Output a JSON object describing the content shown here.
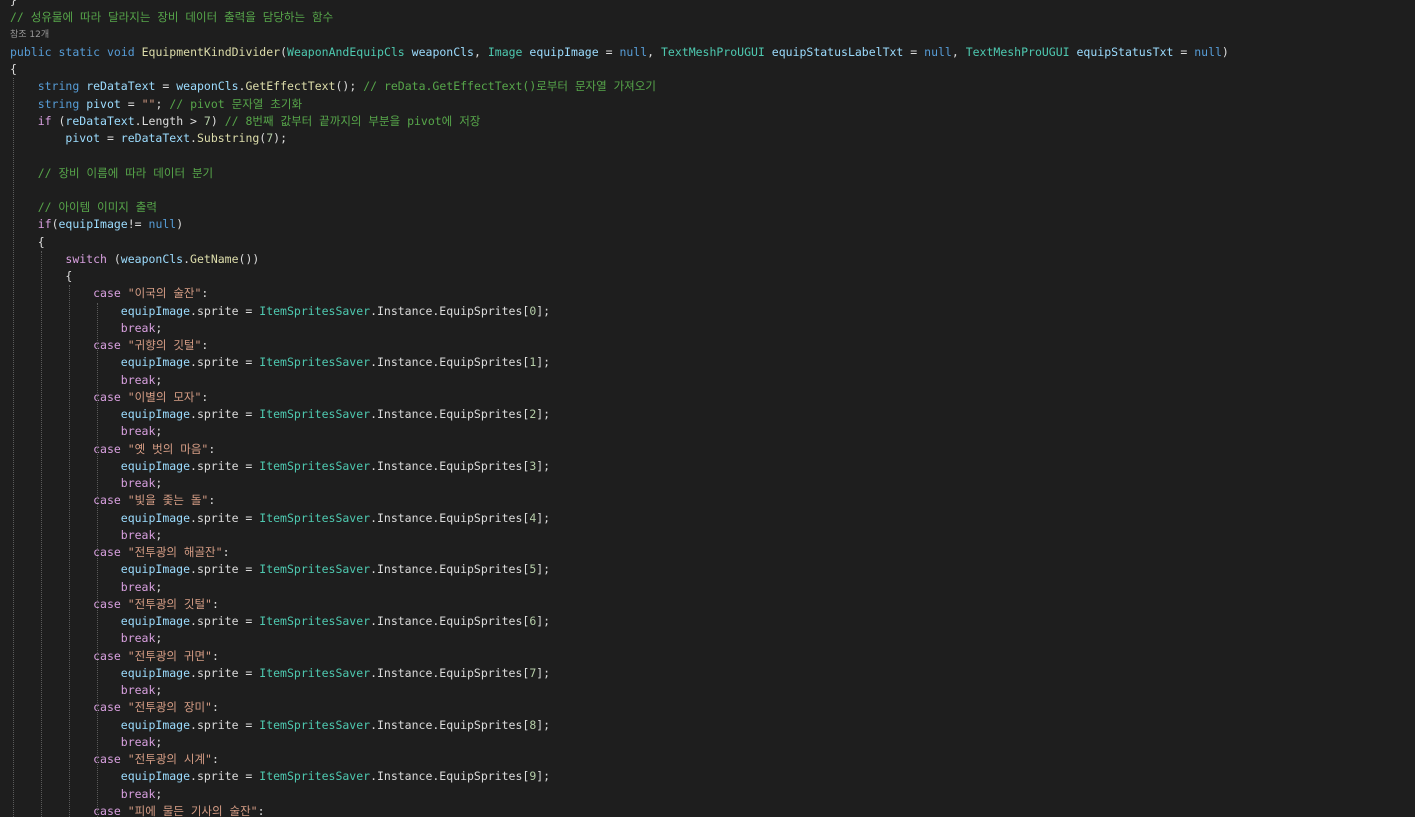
{
  "colors": {
    "background": "#1e1e1e",
    "plain": "#dcdcdc",
    "keyword": "#569cd6",
    "control": "#d8a0df",
    "comment": "#57a64a",
    "string": "#d69d85",
    "type": "#4ec9b0",
    "method": "#dcdcaa",
    "variable": "#9cdcfe",
    "number": "#b5cea8",
    "codelens": "#999999"
  },
  "code": {
    "codelens": "참조 12개",
    "lines": [
      [
        [
          "pl",
          "}"
        ]
      ],
      [
        [
          "cm",
          "// 성유물에 따라 달라지는 장비 데이터 출력을 담당하는 함수"
        ]
      ],
      "codelens",
      [
        [
          "kw",
          "public"
        ],
        [
          "pl",
          " "
        ],
        [
          "kw",
          "static"
        ],
        [
          "pl",
          " "
        ],
        [
          "kw",
          "void"
        ],
        [
          "pl",
          " "
        ],
        [
          "fn",
          "EquipmentKindDivider"
        ],
        [
          "pl",
          "("
        ],
        [
          "type",
          "WeaponAndEquipCls"
        ],
        [
          "pl",
          " "
        ],
        [
          "var",
          "weaponCls"
        ],
        [
          "pl",
          ", "
        ],
        [
          "type",
          "Image"
        ],
        [
          "pl",
          " "
        ],
        [
          "var",
          "equipImage"
        ],
        [
          "pl",
          " = "
        ],
        [
          "kw",
          "null"
        ],
        [
          "pl",
          ", "
        ],
        [
          "type",
          "TextMeshProUGUI"
        ],
        [
          "pl",
          " "
        ],
        [
          "var",
          "equipStatusLabelTxt"
        ],
        [
          "pl",
          " = "
        ],
        [
          "kw",
          "null"
        ],
        [
          "pl",
          ", "
        ],
        [
          "type",
          "TextMeshProUGUI"
        ],
        [
          "pl",
          " "
        ],
        [
          "var",
          "equipStatusTxt"
        ],
        [
          "pl",
          " = "
        ],
        [
          "kw",
          "null"
        ],
        [
          "pl",
          ")"
        ]
      ],
      [
        [
          "pl",
          "{"
        ]
      ],
      [
        [
          "pl",
          "    "
        ],
        [
          "kw",
          "string"
        ],
        [
          "pl",
          " "
        ],
        [
          "var",
          "reDataText"
        ],
        [
          "pl",
          " = "
        ],
        [
          "var",
          "weaponCls"
        ],
        [
          "pl",
          "."
        ],
        [
          "fn",
          "GetEffectText"
        ],
        [
          "pl",
          "(); "
        ],
        [
          "cm",
          "// reData.GetEffectText()로부터 문자열 가져오기"
        ]
      ],
      [
        [
          "pl",
          "    "
        ],
        [
          "kw",
          "string"
        ],
        [
          "pl",
          " "
        ],
        [
          "var",
          "pivot"
        ],
        [
          "pl",
          " = "
        ],
        [
          "str",
          "\"\""
        ],
        [
          "pl",
          "; "
        ],
        [
          "cm",
          "// pivot 문자열 초기화"
        ]
      ],
      [
        [
          "pl",
          "    "
        ],
        [
          "ctl",
          "if"
        ],
        [
          "pl",
          " ("
        ],
        [
          "var",
          "reDataText"
        ],
        [
          "pl",
          ".Length > "
        ],
        [
          "num",
          "7"
        ],
        [
          "pl",
          ") "
        ],
        [
          "cm",
          "// 8번째 값부터 끝까지의 부분을 pivot에 저장"
        ]
      ],
      [
        [
          "pl",
          "        "
        ],
        [
          "var",
          "pivot"
        ],
        [
          "pl",
          " = "
        ],
        [
          "var",
          "reDataText"
        ],
        [
          "pl",
          "."
        ],
        [
          "fn",
          "Substring"
        ],
        [
          "pl",
          "("
        ],
        [
          "num",
          "7"
        ],
        [
          "pl",
          ");"
        ]
      ],
      [],
      [
        [
          "pl",
          "    "
        ],
        [
          "cm",
          "// 장비 이름에 따라 데이터 분기"
        ]
      ],
      [],
      [
        [
          "pl",
          "    "
        ],
        [
          "cm",
          "// 아이템 이미지 출력"
        ]
      ],
      [
        [
          "pl",
          "    "
        ],
        [
          "ctl",
          "if"
        ],
        [
          "pl",
          "("
        ],
        [
          "var",
          "equipImage"
        ],
        [
          "pl",
          "!= "
        ],
        [
          "kw",
          "null"
        ],
        [
          "pl",
          ")"
        ]
      ],
      [
        [
          "pl",
          "    {"
        ]
      ],
      [
        [
          "pl",
          "        "
        ],
        [
          "ctl",
          "switch"
        ],
        [
          "pl",
          " ("
        ],
        [
          "var",
          "weaponCls"
        ],
        [
          "pl",
          "."
        ],
        [
          "fn",
          "GetName"
        ],
        [
          "pl",
          "())"
        ]
      ],
      [
        [
          "pl",
          "        {"
        ]
      ],
      [
        [
          "pl",
          "            "
        ],
        [
          "ctl",
          "case"
        ],
        [
          "pl",
          " "
        ],
        [
          "str",
          "\"이국의 술잔\""
        ],
        [
          "pl",
          ":"
        ]
      ],
      [
        [
          "pl",
          "                "
        ],
        [
          "var",
          "equipImage"
        ],
        [
          "pl",
          ".sprite = "
        ],
        [
          "type",
          "ItemSpritesSaver"
        ],
        [
          "pl",
          ".Instance.EquipSprites["
        ],
        [
          "num",
          "0"
        ],
        [
          "pl",
          "];"
        ]
      ],
      [
        [
          "pl",
          "                "
        ],
        [
          "ctl",
          "break"
        ],
        [
          "pl",
          ";"
        ]
      ],
      [
        [
          "pl",
          "            "
        ],
        [
          "ctl",
          "case"
        ],
        [
          "pl",
          " "
        ],
        [
          "str",
          "\"귀향의 깃털\""
        ],
        [
          "pl",
          ":"
        ]
      ],
      [
        [
          "pl",
          "                "
        ],
        [
          "var",
          "equipImage"
        ],
        [
          "pl",
          ".sprite = "
        ],
        [
          "type",
          "ItemSpritesSaver"
        ],
        [
          "pl",
          ".Instance.EquipSprites["
        ],
        [
          "num",
          "1"
        ],
        [
          "pl",
          "];"
        ]
      ],
      [
        [
          "pl",
          "                "
        ],
        [
          "ctl",
          "break"
        ],
        [
          "pl",
          ";"
        ]
      ],
      [
        [
          "pl",
          "            "
        ],
        [
          "ctl",
          "case"
        ],
        [
          "pl",
          " "
        ],
        [
          "str",
          "\"이별의 모자\""
        ],
        [
          "pl",
          ":"
        ]
      ],
      [
        [
          "pl",
          "                "
        ],
        [
          "var",
          "equipImage"
        ],
        [
          "pl",
          ".sprite = "
        ],
        [
          "type",
          "ItemSpritesSaver"
        ],
        [
          "pl",
          ".Instance.EquipSprites["
        ],
        [
          "num",
          "2"
        ],
        [
          "pl",
          "];"
        ]
      ],
      [
        [
          "pl",
          "                "
        ],
        [
          "ctl",
          "break"
        ],
        [
          "pl",
          ";"
        ]
      ],
      [
        [
          "pl",
          "            "
        ],
        [
          "ctl",
          "case"
        ],
        [
          "pl",
          " "
        ],
        [
          "str",
          "\"옛 벗의 마음\""
        ],
        [
          "pl",
          ":"
        ]
      ],
      [
        [
          "pl",
          "                "
        ],
        [
          "var",
          "equipImage"
        ],
        [
          "pl",
          ".sprite = "
        ],
        [
          "type",
          "ItemSpritesSaver"
        ],
        [
          "pl",
          ".Instance.EquipSprites["
        ],
        [
          "num",
          "3"
        ],
        [
          "pl",
          "];"
        ]
      ],
      [
        [
          "pl",
          "                "
        ],
        [
          "ctl",
          "break"
        ],
        [
          "pl",
          ";"
        ]
      ],
      [
        [
          "pl",
          "            "
        ],
        [
          "ctl",
          "case"
        ],
        [
          "pl",
          " "
        ],
        [
          "str",
          "\"빛을 좇는 돌\""
        ],
        [
          "pl",
          ":"
        ]
      ],
      [
        [
          "pl",
          "                "
        ],
        [
          "var",
          "equipImage"
        ],
        [
          "pl",
          ".sprite = "
        ],
        [
          "type",
          "ItemSpritesSaver"
        ],
        [
          "pl",
          ".Instance.EquipSprites["
        ],
        [
          "num",
          "4"
        ],
        [
          "pl",
          "];"
        ]
      ],
      [
        [
          "pl",
          "                "
        ],
        [
          "ctl",
          "break"
        ],
        [
          "pl",
          ";"
        ]
      ],
      [
        [
          "pl",
          "            "
        ],
        [
          "ctl",
          "case"
        ],
        [
          "pl",
          " "
        ],
        [
          "str",
          "\"전투광의 해골잔\""
        ],
        [
          "pl",
          ":"
        ]
      ],
      [
        [
          "pl",
          "                "
        ],
        [
          "var",
          "equipImage"
        ],
        [
          "pl",
          ".sprite = "
        ],
        [
          "type",
          "ItemSpritesSaver"
        ],
        [
          "pl",
          ".Instance.EquipSprites["
        ],
        [
          "num",
          "5"
        ],
        [
          "pl",
          "];"
        ]
      ],
      [
        [
          "pl",
          "                "
        ],
        [
          "ctl",
          "break"
        ],
        [
          "pl",
          ";"
        ]
      ],
      [
        [
          "pl",
          "            "
        ],
        [
          "ctl",
          "case"
        ],
        [
          "pl",
          " "
        ],
        [
          "str",
          "\"전투광의 깃털\""
        ],
        [
          "pl",
          ":"
        ]
      ],
      [
        [
          "pl",
          "                "
        ],
        [
          "var",
          "equipImage"
        ],
        [
          "pl",
          ".sprite = "
        ],
        [
          "type",
          "ItemSpritesSaver"
        ],
        [
          "pl",
          ".Instance.EquipSprites["
        ],
        [
          "num",
          "6"
        ],
        [
          "pl",
          "];"
        ]
      ],
      [
        [
          "pl",
          "                "
        ],
        [
          "ctl",
          "break"
        ],
        [
          "pl",
          ";"
        ]
      ],
      [
        [
          "pl",
          "            "
        ],
        [
          "ctl",
          "case"
        ],
        [
          "pl",
          " "
        ],
        [
          "str",
          "\"전투광의 귀면\""
        ],
        [
          "pl",
          ":"
        ]
      ],
      [
        [
          "pl",
          "                "
        ],
        [
          "var",
          "equipImage"
        ],
        [
          "pl",
          ".sprite = "
        ],
        [
          "type",
          "ItemSpritesSaver"
        ],
        [
          "pl",
          ".Instance.EquipSprites["
        ],
        [
          "num",
          "7"
        ],
        [
          "pl",
          "];"
        ]
      ],
      [
        [
          "pl",
          "                "
        ],
        [
          "ctl",
          "break"
        ],
        [
          "pl",
          ";"
        ]
      ],
      [
        [
          "pl",
          "            "
        ],
        [
          "ctl",
          "case"
        ],
        [
          "pl",
          " "
        ],
        [
          "str",
          "\"전투광의 장미\""
        ],
        [
          "pl",
          ":"
        ]
      ],
      [
        [
          "pl",
          "                "
        ],
        [
          "var",
          "equipImage"
        ],
        [
          "pl",
          ".sprite = "
        ],
        [
          "type",
          "ItemSpritesSaver"
        ],
        [
          "pl",
          ".Instance.EquipSprites["
        ],
        [
          "num",
          "8"
        ],
        [
          "pl",
          "];"
        ]
      ],
      [
        [
          "pl",
          "                "
        ],
        [
          "ctl",
          "break"
        ],
        [
          "pl",
          ";"
        ]
      ],
      [
        [
          "pl",
          "            "
        ],
        [
          "ctl",
          "case"
        ],
        [
          "pl",
          " "
        ],
        [
          "str",
          "\"전투광의 시계\""
        ],
        [
          "pl",
          ":"
        ]
      ],
      [
        [
          "pl",
          "                "
        ],
        [
          "var",
          "equipImage"
        ],
        [
          "pl",
          ".sprite = "
        ],
        [
          "type",
          "ItemSpritesSaver"
        ],
        [
          "pl",
          ".Instance.EquipSprites["
        ],
        [
          "num",
          "9"
        ],
        [
          "pl",
          "];"
        ]
      ],
      [
        [
          "pl",
          "                "
        ],
        [
          "ctl",
          "break"
        ],
        [
          "pl",
          ";"
        ]
      ],
      [
        [
          "pl",
          "            "
        ],
        [
          "ctl",
          "case"
        ],
        [
          "pl",
          " "
        ],
        [
          "str",
          "\"피에 물든 기사의 술잔\""
        ],
        [
          "pl",
          ":"
        ]
      ]
    ]
  }
}
